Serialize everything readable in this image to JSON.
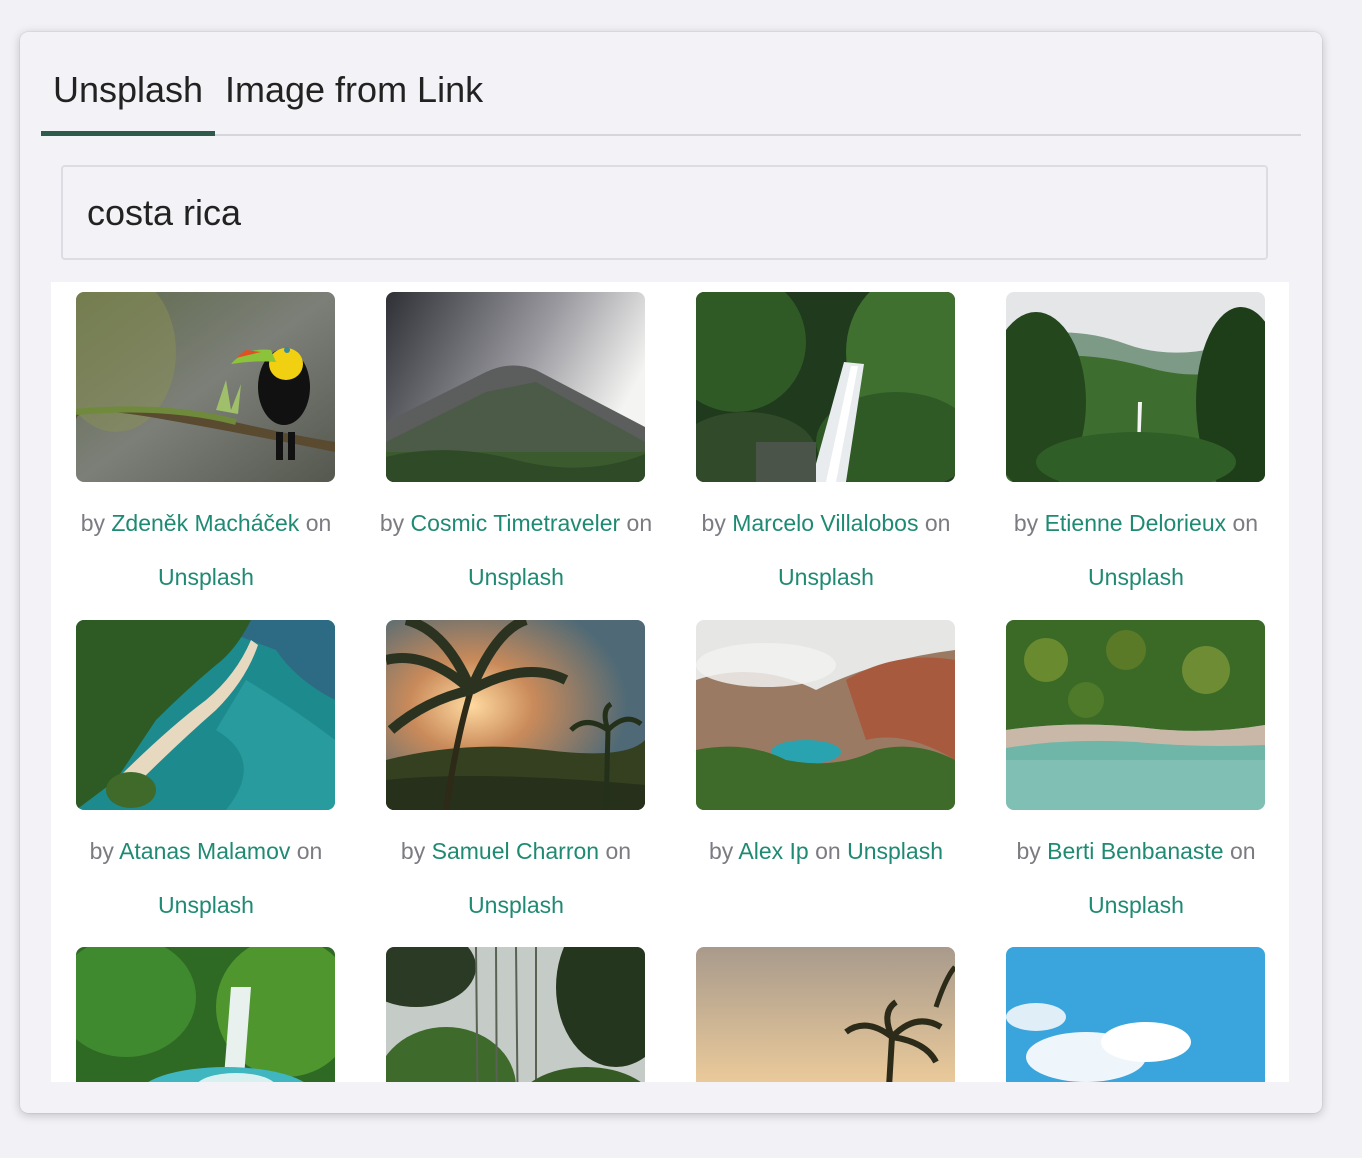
{
  "tabs": [
    {
      "label": "Unsplash",
      "active": true
    },
    {
      "label": "Image from Link",
      "active": false
    }
  ],
  "search": {
    "value": "costa rica"
  },
  "credit": {
    "prefix": "by",
    "mid": "on",
    "site": "Unsplash"
  },
  "photos": [
    {
      "author": "Zdeněk Macháček",
      "subject": "toucan-on-branch"
    },
    {
      "author": "Cosmic Timetraveler",
      "subject": "volcano"
    },
    {
      "author": "Marcelo Villalobos",
      "subject": "jungle-waterfall"
    },
    {
      "author": "Etienne Delorieux",
      "subject": "rainforest-valley"
    },
    {
      "author": "Atanas Malamov",
      "subject": "aerial-beach"
    },
    {
      "author": "Samuel Charron",
      "subject": "palm-sunset"
    },
    {
      "author": "Alex Ip",
      "subject": "crater-lake"
    },
    {
      "author": "Berti Benbanaste",
      "subject": "aerial-coast"
    },
    {
      "author": "",
      "subject": "turquoise-waterfall"
    },
    {
      "author": "",
      "subject": "forest-vines"
    },
    {
      "author": "",
      "subject": "palm-dusk"
    },
    {
      "author": "",
      "subject": "blue-sky-clouds"
    }
  ],
  "colors": {
    "accent": "#1f8a73",
    "tab_indicator": "#2e5a4c"
  }
}
